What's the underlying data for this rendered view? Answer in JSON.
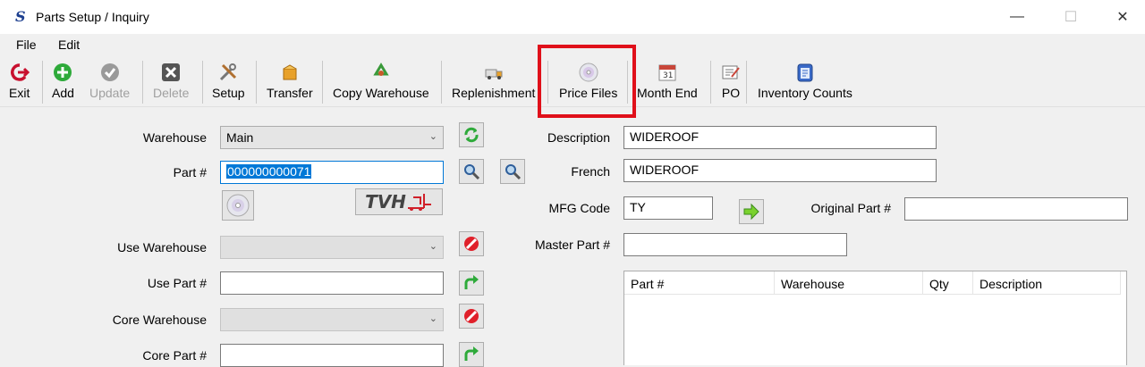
{
  "window": {
    "title": "Parts Setup / Inquiry",
    "app_icon_glyph": "S",
    "minimize": "—",
    "maximize": "☐",
    "close": "✕"
  },
  "menu": {
    "file": "File",
    "edit": "Edit"
  },
  "toolbar": {
    "exit": "Exit",
    "add": "Add",
    "update": "Update",
    "delete": "Delete",
    "setup": "Setup",
    "transfer": "Transfer",
    "copy_warehouse": "Copy Warehouse",
    "replenishment": "Replenishment",
    "price_files": "Price Files",
    "month_end": "Month End",
    "po": "PO",
    "inventory_counts": "Inventory Counts"
  },
  "form": {
    "warehouse_label": "Warehouse",
    "warehouse_value": "Main",
    "part_label": "Part #",
    "part_value": "000000000071",
    "brand_logo_text": "TVH",
    "use_warehouse_label": "Use Warehouse",
    "use_warehouse_value": "",
    "use_part_label": "Use Part #",
    "use_part_value": "",
    "core_warehouse_label": "Core Warehouse",
    "core_warehouse_value": "",
    "core_part_label": "Core Part #",
    "core_part_value": "",
    "description_label": "Description",
    "description_value": "WIDEROOF",
    "french_label": "French",
    "french_value": "WIDEROOF",
    "mfg_code_label": "MFG Code",
    "mfg_code_value": "TY",
    "original_part_label": "Original Part #",
    "original_part_value": "",
    "master_part_label": "Master Part #",
    "master_part_value": ""
  },
  "grid": {
    "columns": [
      "Part #",
      "Warehouse",
      "Qty",
      "Description"
    ],
    "rows": []
  },
  "colors": {
    "highlight": "#e0101a",
    "selection": "#0078d7",
    "accent_green": "#3aa83a"
  }
}
